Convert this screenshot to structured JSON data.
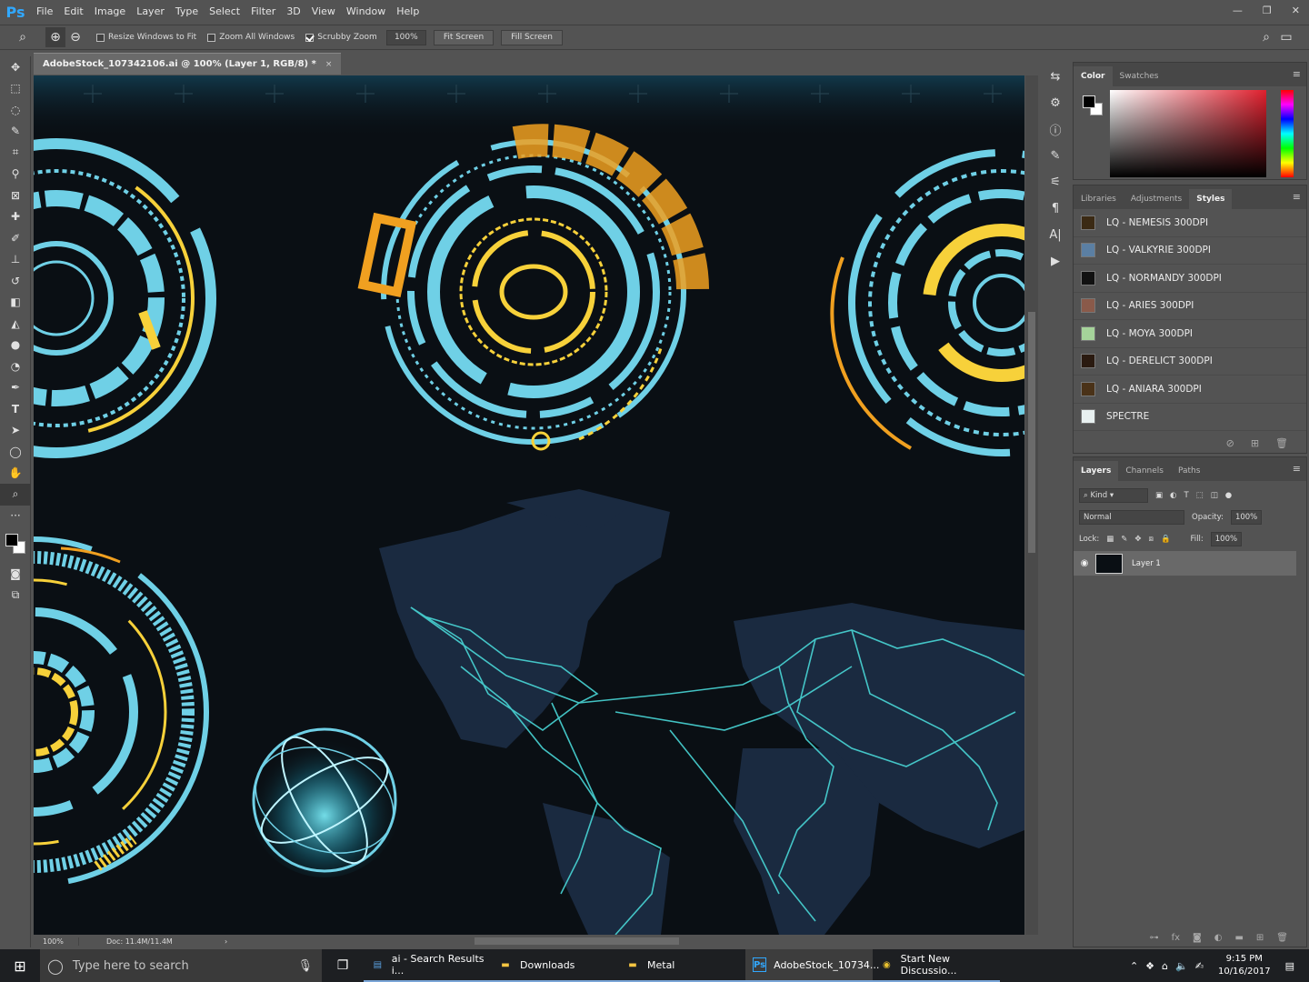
{
  "app": {
    "logo": "Ps"
  },
  "menubar": {
    "items": [
      "File",
      "Edit",
      "Image",
      "Layer",
      "Type",
      "Select",
      "Filter",
      "3D",
      "View",
      "Window",
      "Help"
    ],
    "window_controls": [
      "—",
      "❐",
      "✕"
    ]
  },
  "options": {
    "resize_windows_label": "Resize Windows to Fit",
    "resize_windows_checked": false,
    "zoom_all_label": "Zoom All Windows",
    "zoom_all_checked": false,
    "scrubby_label": "Scrubby Zoom",
    "scrubby_checked": true,
    "zoom_value": "100%",
    "fit_screen_label": "Fit Screen",
    "fill_screen_label": "Fill Screen"
  },
  "document": {
    "tab_title": "AdobeStock_107342106.ai @ 100% (Layer 1, RGB/8) *",
    "tab_close": "×"
  },
  "status": {
    "zoom": "100%",
    "doc": "Doc: 11.4M/11.4M",
    "arrow": "›"
  },
  "toolbar": {
    "tools": [
      "move-tool",
      "marquee-tool",
      "lasso-tool",
      "quick-select-tool",
      "crop-tool",
      "eyedropper-tool",
      "frame-tool",
      "healing-brush-tool",
      "brush-tool",
      "stamp-tool",
      "history-brush-tool",
      "eraser-tool",
      "paint-bucket-tool",
      "blur-tool",
      "dodge-tool",
      "pen-tool",
      "type-tool",
      "path-select-tool",
      "ellipse-tool",
      "hand-tool",
      "zoom-tool",
      "more-tools"
    ],
    "active_tool": "zoom-tool",
    "foreground_color": "#000000",
    "background_color": "#ffffff"
  },
  "color_panel": {
    "tabs": [
      "Color",
      "Swatches"
    ],
    "active_tab": "Color",
    "foreground": "#000000",
    "background": "#ffffff",
    "hue_color": "#e0202e"
  },
  "styles_panel": {
    "tabs": [
      "Libraries",
      "Adjustments",
      "Styles"
    ],
    "active_tab": "Styles",
    "items": [
      {
        "label": "LQ - NEMESIS 300DPI",
        "swatch": "#3b2a14"
      },
      {
        "label": "LQ - VALKYRIE 300DPI",
        "swatch": "#5b7fa3"
      },
      {
        "label": "LQ - NORMANDY 300DPI",
        "swatch": "#111111"
      },
      {
        "label": "LQ - ARIES 300DPI",
        "swatch": "#8a5a4a"
      },
      {
        "label": "LQ - MOYA 300DPI",
        "swatch": "#a5d39a"
      },
      {
        "label": "LQ - DERELICT 300DPI",
        "swatch": "#2a1a10"
      },
      {
        "label": "LQ - ANIARA 300DPI",
        "swatch": "#4a3218"
      },
      {
        "label": "SPECTRE",
        "swatch": "#e8f0f0"
      }
    ]
  },
  "layers_panel": {
    "tabs": [
      "Layers",
      "Channels",
      "Paths"
    ],
    "active_tab": "Layers",
    "filter_label": "Kind",
    "blend_mode": "Normal",
    "opacity_label": "Opacity:",
    "opacity_value": "100%",
    "lock_label": "Lock:",
    "fill_label": "Fill:",
    "fill_value": "100%",
    "layers": [
      {
        "name": "Layer 1",
        "visible": true
      }
    ]
  },
  "taskbar": {
    "search_placeholder": "Type here to search",
    "tasks": [
      {
        "label": "ai - Search Results i...",
        "icon": "file-explorer-search-icon",
        "glyph": "▤",
        "active": false
      },
      {
        "label": "Downloads",
        "icon": "folder-icon",
        "glyph": "▬",
        "active": false
      },
      {
        "label": "Metal",
        "icon": "folder-icon",
        "glyph": "▬",
        "active": false
      },
      {
        "label": "AdobeStock_10734...",
        "icon": "photoshop-icon",
        "glyph": "Ps",
        "active": true
      },
      {
        "label": "Start New Discussio...",
        "icon": "chrome-icon",
        "glyph": "◉",
        "active": false
      }
    ],
    "time": "9:15 PM",
    "date": "10/16/2017"
  },
  "colors": {
    "hud_cyan": "#6fd0e6",
    "hud_yellow": "#f7d13a",
    "hud_orange": "#f0a020",
    "map_land": "#1a2a40",
    "map_lines": "#49d6d6",
    "canvas_bg": "#0a0f14"
  }
}
